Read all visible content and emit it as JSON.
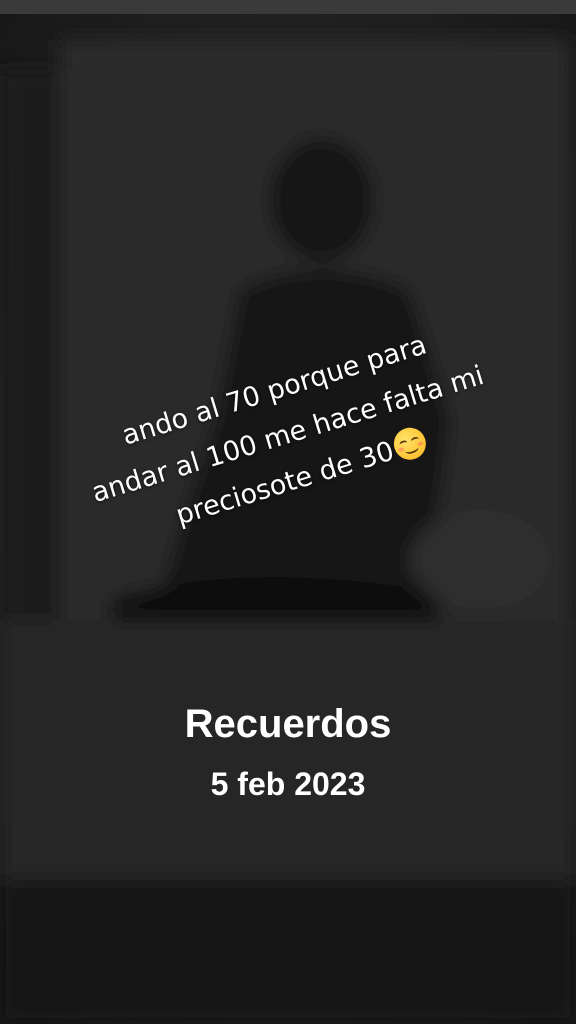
{
  "caption": {
    "line1": "ando al 70 porque para",
    "line2": "andar al 100 me hace falta mi",
    "line3": "preciosote de 30",
    "emoji": "smiling-face-icon"
  },
  "memories": {
    "title": "Recuerdos",
    "date": "5 feb 2023"
  }
}
